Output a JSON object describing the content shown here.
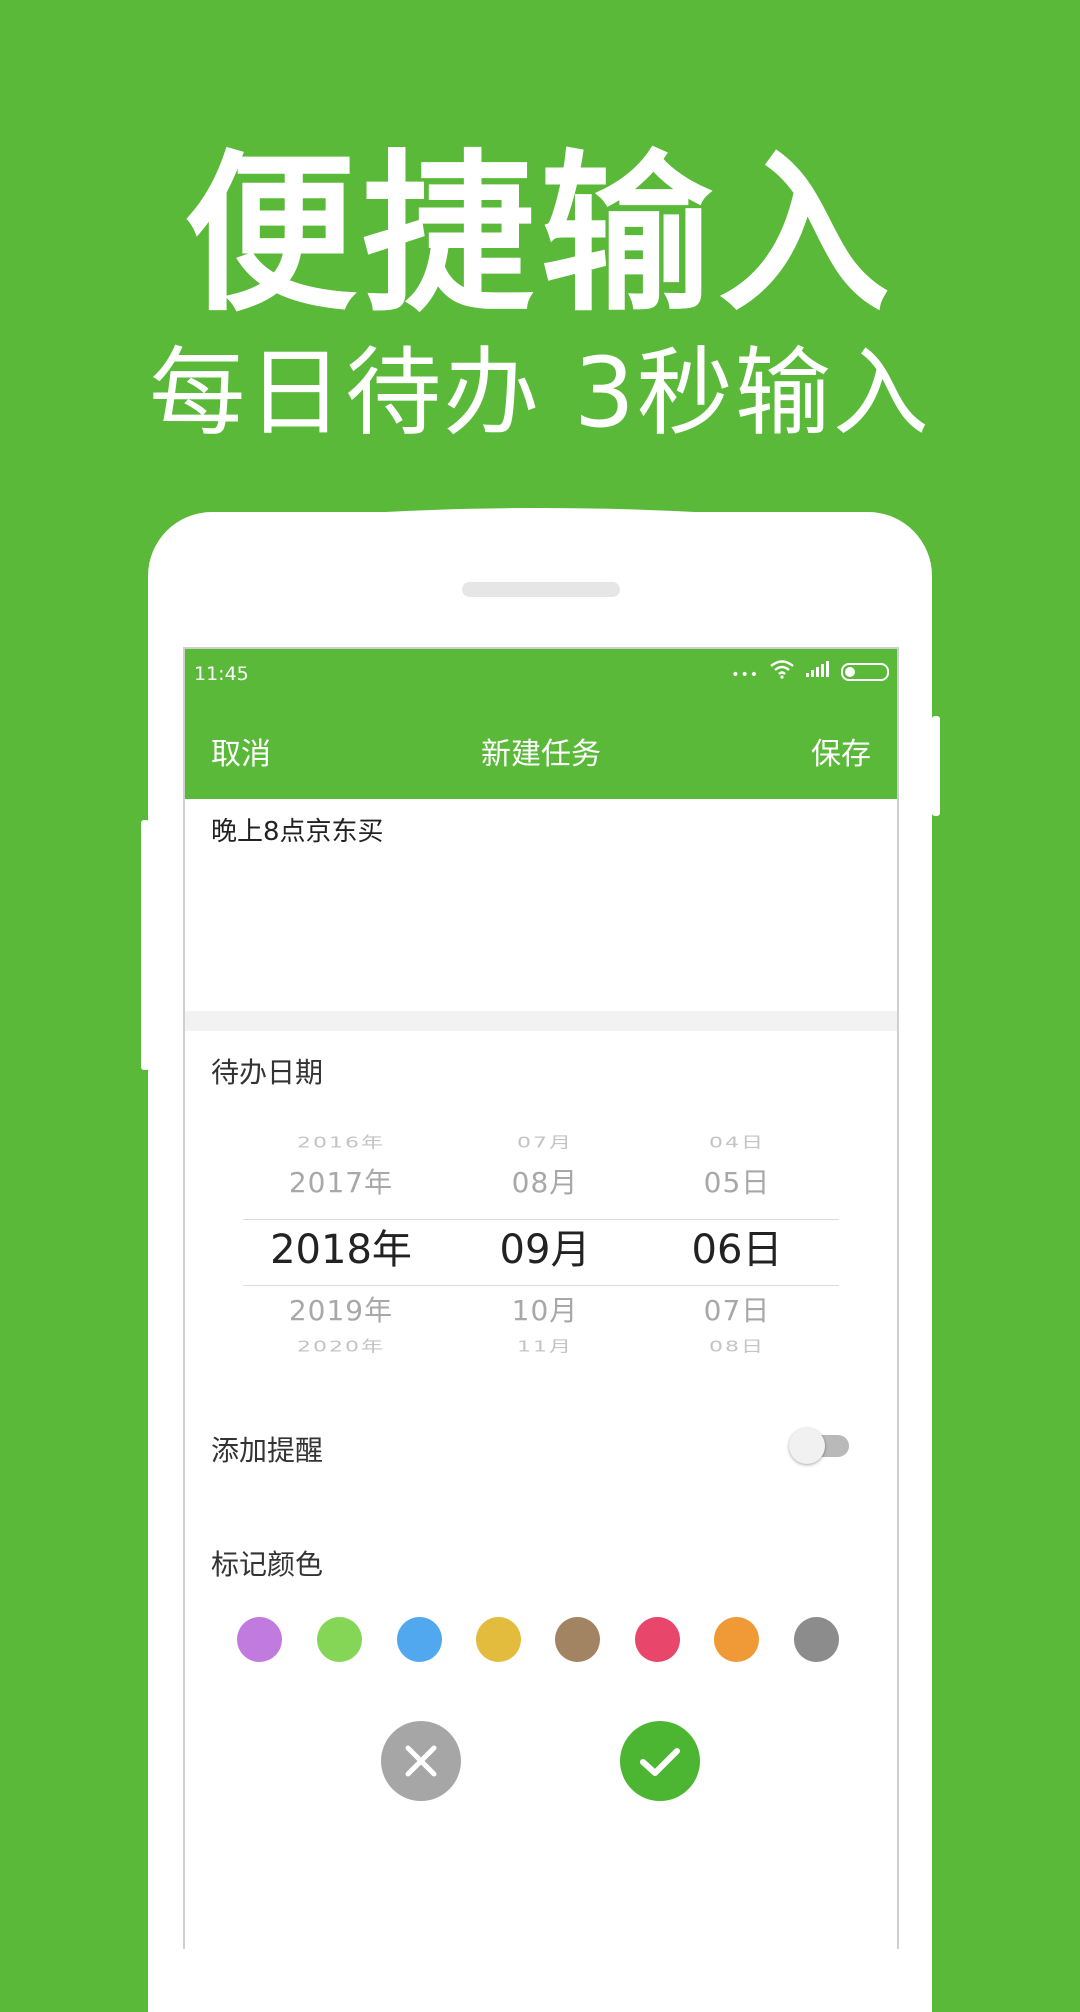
{
  "promo": {
    "headline": "便捷输入",
    "subline": "每日待办 3秒输入"
  },
  "status_bar": {
    "time": "11:45",
    "dots": "•••",
    "icons": [
      "wifi-icon",
      "signal-icon",
      "battery-icon"
    ]
  },
  "app_bar": {
    "cancel_label": "取消",
    "title": "新建任务",
    "save_label": "保存"
  },
  "task": {
    "text": "晚上8点京东买"
  },
  "date_section": {
    "label": "待办日期",
    "years": [
      "2016年",
      "2017年",
      "2018年",
      "2019年",
      "2020年"
    ],
    "months": [
      "07月",
      "08月",
      "09月",
      "10月",
      "11月"
    ],
    "days": [
      "04日",
      "05日",
      "06日",
      "07日",
      "08日"
    ],
    "selected": {
      "year": "2018年",
      "month": "09月",
      "day": "06日"
    }
  },
  "reminder": {
    "label": "添加提醒",
    "enabled": false
  },
  "color_section": {
    "label": "标记颜色",
    "colors": [
      "#c17bdf",
      "#85d657",
      "#52a8ef",
      "#e4bc3d",
      "#a28463",
      "#e8466a",
      "#ef9a36",
      "#8c8c8c"
    ]
  },
  "actions": {
    "cancel_icon": "close-icon",
    "confirm_icon": "check-icon"
  },
  "theme": {
    "brand_green": "#5bb939"
  }
}
